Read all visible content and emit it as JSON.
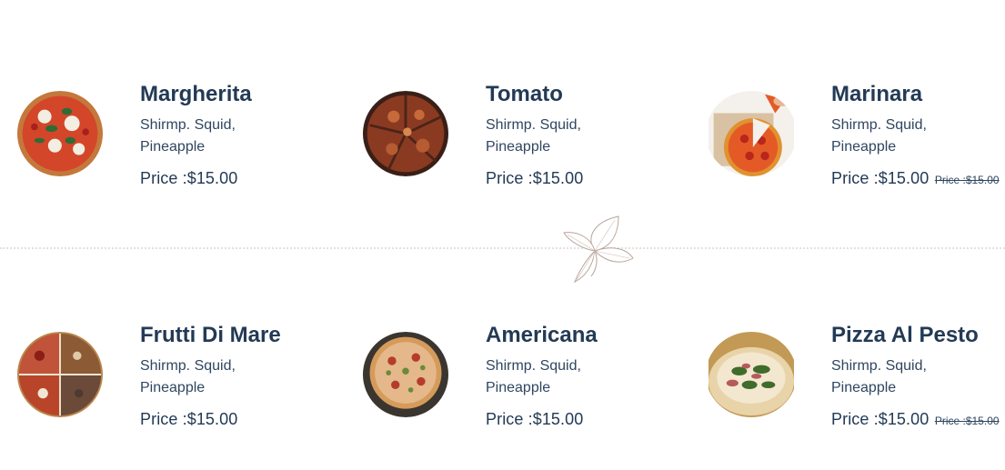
{
  "menu": {
    "items": [
      {
        "title": "Margherita",
        "description": "Shirmp. Squid, Pineapple",
        "price": "Price :$15.00",
        "old_price": ""
      },
      {
        "title": "Tomato",
        "description": "Shirmp. Squid, Pineapple",
        "price": "Price :$15.00",
        "old_price": ""
      },
      {
        "title": "Marinara",
        "description": "Shirmp. Squid, Pineapple",
        "price": "Price :$15.00",
        "old_price": "Price :$15.00"
      },
      {
        "title": "Frutti Di Mare",
        "description": "Shirmp. Squid, Pineapple",
        "price": "Price :$15.00",
        "old_price": ""
      },
      {
        "title": "Americana",
        "description": "Shirmp. Squid, Pineapple",
        "price": "Price :$15.00",
        "old_price": ""
      },
      {
        "title": "Pizza Al Pesto",
        "description": "Shirmp. Squid, Pineapple",
        "price": "Price :$15.00",
        "old_price": "Price :$15.00"
      }
    ]
  },
  "colors": {
    "heading": "#233a55",
    "divider": "#e4e1df",
    "ornament": "#b9a39a"
  },
  "icons": {
    "divider_ornament": "basil-leaf-icon"
  }
}
